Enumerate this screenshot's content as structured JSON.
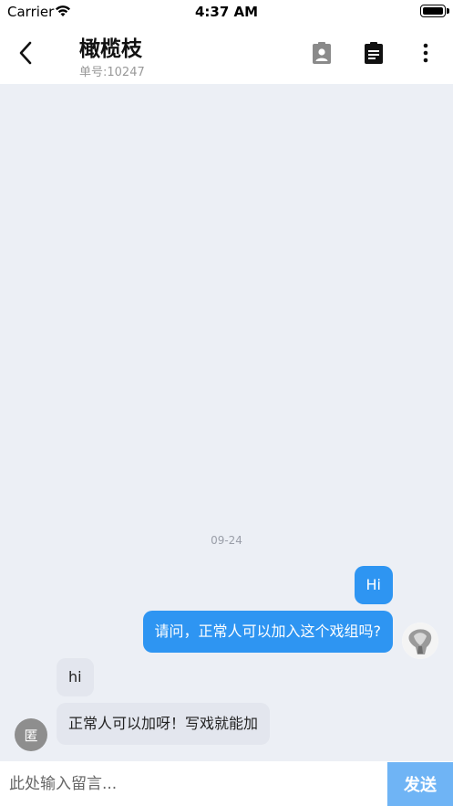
{
  "status_bar": {
    "carrier": "Carrier",
    "time": "4:37 AM"
  },
  "header": {
    "title": "橄榄枝",
    "order_number": "单号:10247",
    "icons": [
      "back-chevron-icon",
      "contact-card-icon",
      "clipboard-icon",
      "more-vertical-icon"
    ]
  },
  "chat": {
    "date_separator": "09-24",
    "messages": [
      {
        "direction": "out",
        "text": "Hi"
      },
      {
        "direction": "out",
        "text": "请问，正常人可以加入这个戏组吗?"
      },
      {
        "direction": "in",
        "text": "hi"
      },
      {
        "direction": "in",
        "text": "正常人可以加呀！写戏就能加"
      }
    ],
    "agent_avatar_text": "匿"
  },
  "input_bar": {
    "placeholder": "此处输入留言...",
    "value": "",
    "send_label": "发送"
  },
  "colors": {
    "outgoing_bubble": "#2e95f2",
    "incoming_bubble": "#e3e6ee",
    "chat_background": "#eceff5",
    "send_button": "#6fb4f5"
  }
}
